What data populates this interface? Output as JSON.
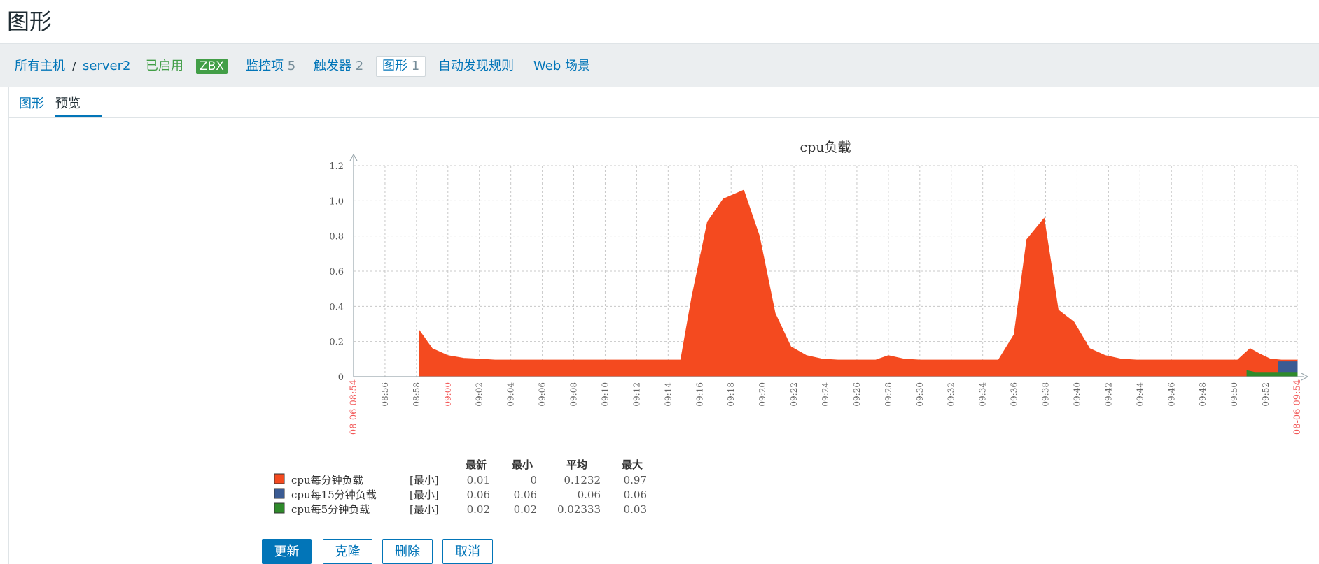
{
  "page": {
    "title": "图形"
  },
  "nav": {
    "all_hosts": "所有主机",
    "separator": "/",
    "host": "server2",
    "status": "已启用",
    "badge": "ZBX",
    "items_label": "监控项",
    "items_count": "5",
    "triggers_label": "触发器",
    "triggers_count": "2",
    "graphs_label": "图形",
    "graphs_count": "1",
    "discovery": "自动发现规则",
    "web": "Web 场景"
  },
  "tabs": {
    "graph": "图形",
    "preview": "预览"
  },
  "buttons": {
    "update": "更新",
    "clone": "克隆",
    "delete": "删除",
    "cancel": "取消"
  },
  "legend_headers": [
    "最新",
    "最小",
    "平均",
    "最大"
  ],
  "chart_data": {
    "type": "area",
    "title": "cpu负载",
    "xlabel": "",
    "ylabel": "",
    "ylim": [
      0,
      1.2
    ],
    "yticks": [
      "0",
      "0.2",
      "0.4",
      "0.6",
      "0.8",
      "1.0",
      "1.2"
    ],
    "grid": true,
    "x_start_label": "08-06 08:54",
    "x_end_label": "08-06 09:54",
    "x_ticks": [
      "08:56",
      "08:58",
      "09:00",
      "09:02",
      "09:04",
      "09:06",
      "09:08",
      "09:10",
      "09:12",
      "09:14",
      "09:16",
      "09:18",
      "09:20",
      "09:22",
      "09:24",
      "09:26",
      "09:28",
      "09:30",
      "09:32",
      "09:34",
      "09:36",
      "09:38",
      "09:40",
      "09:42",
      "09:44",
      "09:46",
      "09:48",
      "09:50",
      "09:52"
    ],
    "x_ticks_highlight": [
      "09:00"
    ],
    "x_range_minutes": [
      0,
      60
    ],
    "series": [
      {
        "name": "cpu每分钟负载",
        "color": "#f44a1f",
        "func": "[最小]",
        "last": "0.01",
        "min": "0",
        "avg": "0.1232",
        "max": "0.97",
        "points": [
          [
            4.2,
            0.26
          ],
          [
            5,
            0.16
          ],
          [
            6,
            0.12
          ],
          [
            7,
            0.105
          ],
          [
            8,
            0.1
          ],
          [
            9,
            0.095
          ],
          [
            15,
            0.095
          ],
          [
            20.8,
            0.095
          ],
          [
            21.5,
            0.45
          ],
          [
            22.5,
            0.88
          ],
          [
            23.5,
            1.01
          ],
          [
            24.8,
            1.06
          ],
          [
            25.8,
            0.8
          ],
          [
            26.8,
            0.36
          ],
          [
            27.8,
            0.17
          ],
          [
            28.8,
            0.12
          ],
          [
            29.8,
            0.1
          ],
          [
            30.8,
            0.095
          ],
          [
            33.2,
            0.095
          ],
          [
            34,
            0.12
          ],
          [
            35,
            0.1
          ],
          [
            36,
            0.095
          ],
          [
            41,
            0.095
          ],
          [
            42,
            0.24
          ],
          [
            42.8,
            0.78
          ],
          [
            43.9,
            0.9
          ],
          [
            44.8,
            0.38
          ],
          [
            45.8,
            0.31
          ],
          [
            46.8,
            0.16
          ],
          [
            47.8,
            0.12
          ],
          [
            48.8,
            0.1
          ],
          [
            49.8,
            0.095
          ],
          [
            56.2,
            0.095
          ],
          [
            57,
            0.16
          ],
          [
            57.6,
            0.13
          ],
          [
            58.3,
            0.1
          ],
          [
            59,
            0.095
          ],
          [
            60,
            0.095
          ]
        ]
      },
      {
        "name": "cpu每15分钟负载",
        "color": "#3b5b93",
        "func": "[最小]",
        "last": "0.06",
        "min": "0.06",
        "avg": "0.06",
        "max": "0.06",
        "points": [
          [
            58.8,
            0.085
          ],
          [
            60,
            0.085
          ]
        ]
      },
      {
        "name": "cpu每5分钟负载",
        "color": "#2f8a2b",
        "func": "[最小]",
        "last": "0.02",
        "min": "0.02",
        "avg": "0.02333",
        "max": "0.03",
        "points": [
          [
            56.8,
            0.035
          ],
          [
            57.3,
            0.025
          ],
          [
            60,
            0.025
          ]
        ]
      }
    ]
  }
}
